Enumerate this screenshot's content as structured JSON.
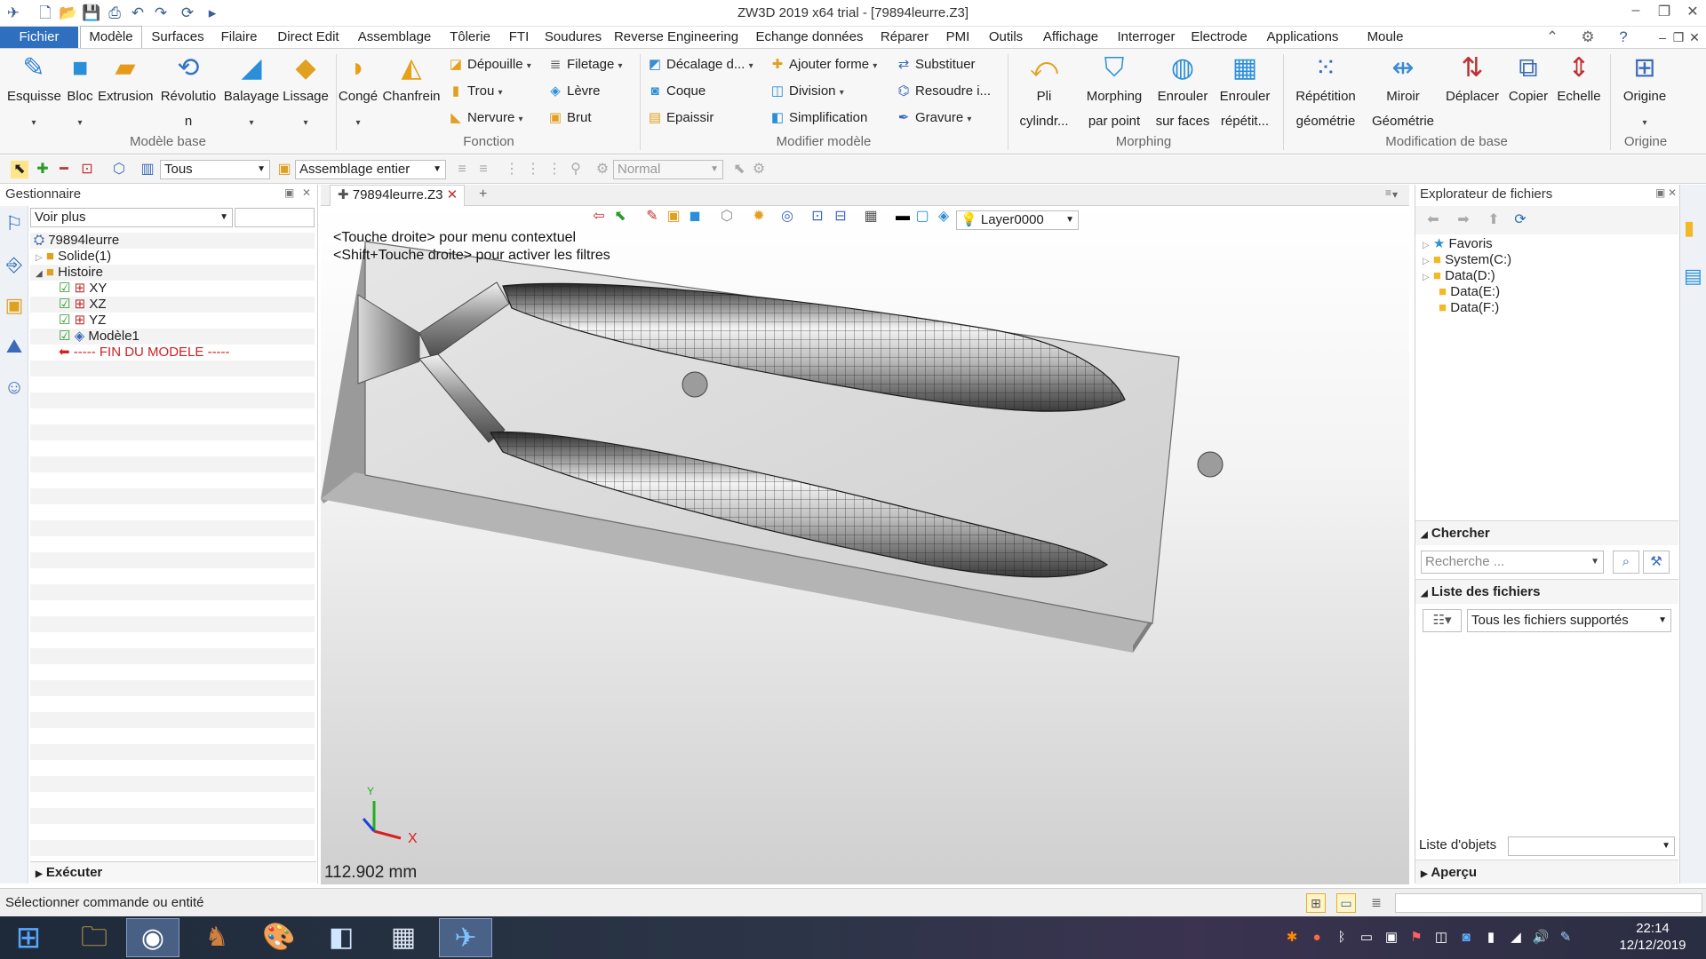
{
  "window": {
    "title": "ZW3D 2019  x64 trial - [79894leurre.Z3]"
  },
  "menubar": {
    "items": [
      "Fichier",
      "Modèle",
      "Surfaces",
      "Filaire",
      "Direct Edit",
      "Assemblage",
      "Tôlerie",
      "FTI",
      "Soudures",
      "Reverse Engineering",
      "Echange données",
      "Réparer",
      "PMI",
      "Outils",
      "Affichage",
      "Interroger",
      "Electrode",
      "Applications",
      "Moule"
    ]
  },
  "ribbon": {
    "modele_base": {
      "label": "Modèle base",
      "buttons": [
        "Esquisse",
        "Bloc",
        "Extrusion",
        "Révolutio",
        "n",
        "Balayage",
        "Lissage"
      ]
    },
    "fonction": {
      "label": "Fonction",
      "buttons": [
        "Congé",
        "Chanfrein"
      ],
      "small": [
        "Dépouille",
        "Filetage",
        "Trou",
        "Lèvre",
        "Nervure",
        "Brut"
      ]
    },
    "modifier": {
      "label": "Modifier modèle",
      "small": [
        "Décalage d...",
        "Ajouter forme",
        "Substituer",
        "Coque",
        "Division",
        "Resoudre i...",
        "Epaissir",
        "Simplification",
        "Gravure"
      ]
    },
    "morphing": {
      "label": "Morphing",
      "buttons": [
        "Pli",
        "cylindr...",
        "Morphing",
        "par point",
        "Enrouler",
        "sur faces",
        "Enrouler",
        "répétit..."
      ]
    },
    "modif_base": {
      "label": "Modification de base",
      "buttons": [
        "Répétition",
        "géométrie",
        "Miroir",
        "Géométrie",
        "Déplacer",
        "Copier",
        "Echelle"
      ]
    },
    "origine": {
      "label": "Origine",
      "buttons": [
        "Origine"
      ]
    }
  },
  "toolbar2": {
    "filter": "Tous",
    "scope": "Assemblage entier",
    "mode": "Normal"
  },
  "left_panel": {
    "title": "Gestionnaire",
    "dropdown": "Voir plus",
    "tree": [
      "79894leurre",
      "Solide(1)",
      "Histoire",
      "XY",
      "XZ",
      "YZ",
      "Modèle1",
      "----- FIN DU MODELE -----"
    ],
    "execute": "Exécuter"
  },
  "document": {
    "tab": "79894leurre.Z3",
    "hint1": "<Touche droite> pour menu contextuel",
    "hint2": "<Shift+Touche droite> pour activer les filtres",
    "layer": "Layer0000",
    "scale_label": "112.902 mm",
    "axis_x": "X",
    "axis_y": "Y"
  },
  "right_panel": {
    "title": "Explorateur de fichiers",
    "tree": [
      "Favoris",
      "System(C:)",
      "Data(D:)",
      "Data(E:)",
      "Data(F:)"
    ],
    "search_header": "Chercher",
    "search_placeholder": "Recherche ...",
    "files_header": "Liste des fichiers",
    "file_filter": "Tous les fichiers supportés",
    "object_list_label": "Liste d'objets",
    "preview": "Aperçu"
  },
  "status": {
    "text": "Sélectionner commande ou entité"
  },
  "taskbar": {
    "time": "22:14",
    "date": "12/12/2019"
  }
}
